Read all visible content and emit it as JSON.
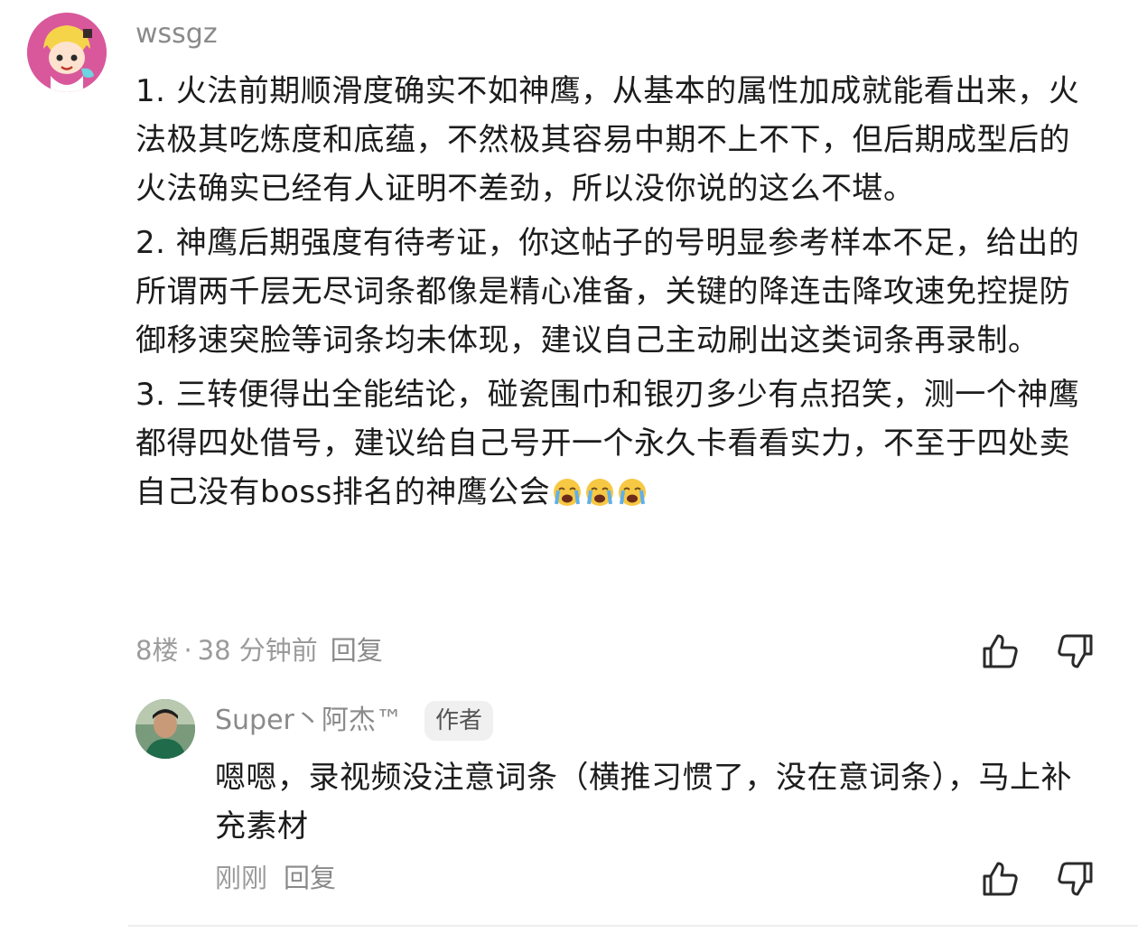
{
  "comment": {
    "username": "wssgz",
    "paragraphs": [
      "1. 火法前期顺滑度确实不如神鹰，从基本的属性加成就能看出来，火法极其吃炼度和底蕴，不然极其容易中期不上不下，但后期成型后的火法确实已经有人证明不差劲，所以没你说的这么不堪。",
      "2. 神鹰后期强度有待考证，你这帖子的号明显参考样本不足，给出的所谓两千层无尽词条都像是精心准备，关键的降连击降攻速免控提防御移速突脸等词条均未体现，建议自己主动刷出这类词条再录制。",
      "3. 三转便得出全能结论，碰瓷围巾和银刃多少有点招笑，测一个神鹰都得四处借号，建议给自己号开一个永久卡看看实力，不至于四处卖自己没有boss排名的神鹰公会"
    ],
    "emoji_count": 3,
    "emoji_icon": "loudly-crying-face",
    "floor": "8楼",
    "separator": "·",
    "time": "38 分钟前",
    "reply_label": "回复"
  },
  "reply": {
    "username": "Super丶阿杰™",
    "badge": "作者",
    "text": "嗯嗯，录视频没注意词条（横推习惯了，没在意词条），马上补充素材",
    "time": "刚刚",
    "reply_label": "回复"
  },
  "colors": {
    "avatar_bg": "#d9589c",
    "meta_text": "#9b9b9b",
    "body_text": "#1c1c1c"
  }
}
